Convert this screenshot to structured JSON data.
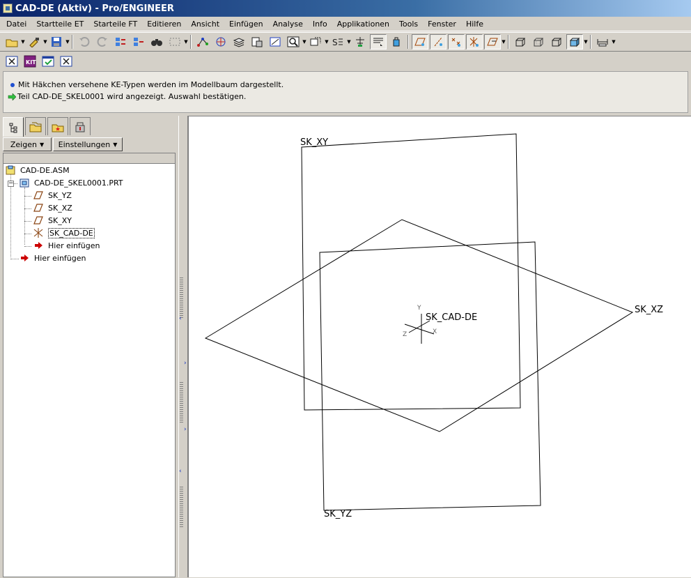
{
  "window": {
    "title": "CAD-DE (Aktiv) - Pro/ENGINEER"
  },
  "menu": [
    "Datei",
    "Startteile ET",
    "Starteile FT",
    "Editieren",
    "Ansicht",
    "Einfügen",
    "Analyse",
    "Info",
    "Applikationen",
    "Tools",
    "Fenster",
    "Hilfe"
  ],
  "messages": [
    "Mit Häkchen versehene KE-Typen werden im Modellbaum dargestellt.",
    "Teil CAD-DE_SKEL0001 wird angezeigt. Auswahl bestätigen."
  ],
  "panel": {
    "show_label": "Zeigen",
    "settings_label": "Einstellungen"
  },
  "tree": {
    "assembly": "CAD-DE.ASM",
    "part": "CAD-DE_SKEL0001.PRT",
    "datum_yz": "SK_YZ",
    "datum_xz": "SK_XZ",
    "datum_xy": "SK_XY",
    "csys": "SK_CAD-DE",
    "insert_here_inner": "Hier einfügen",
    "insert_here_outer": "Hier einfügen"
  },
  "viewport": {
    "label_xy": "SK_XY",
    "label_xz": "SK_XZ",
    "label_yz": "SK_YZ",
    "label_csys": "SK_CAD-DE",
    "axis_x": "X",
    "axis_y": "Y",
    "axis_z": "Z"
  },
  "colors": {
    "title_start": "#0a246a",
    "title_end": "#a6caf0",
    "chrome": "#d4d0c8",
    "insert_arrow": "#cc0000"
  }
}
